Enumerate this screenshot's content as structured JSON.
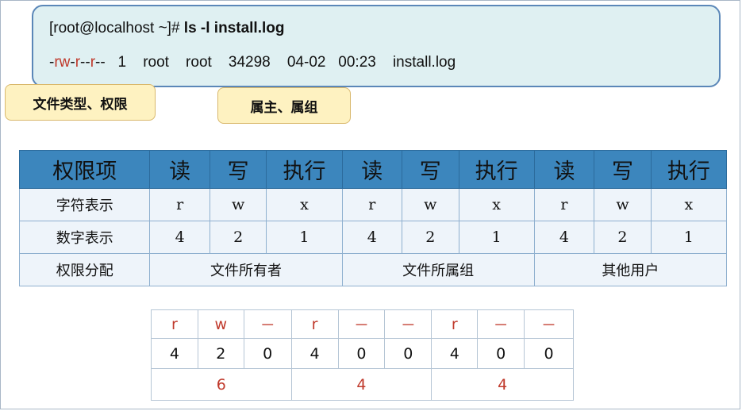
{
  "terminal": {
    "prompt": "[root@localhost ~]# ",
    "command": "ls -l install.log",
    "perm_plain_1": "-",
    "perm_red_1": "rw",
    "perm_plain_2": "-",
    "perm_red_2": "r",
    "perm_plain_3": "--",
    "perm_red_3": "r",
    "perm_plain_4": "--",
    "listing_rest": "   1    root    root    34298    04-02   00:23    install.log"
  },
  "callouts": {
    "type_perm": "文件类型、权限",
    "owner_group": "属主、属组"
  },
  "permission_table": {
    "header": [
      "权限项",
      "读",
      "写",
      "执行",
      "读",
      "写",
      "执行",
      "读",
      "写",
      "执行"
    ],
    "char_row": [
      "字符表示",
      "r",
      "w",
      "x",
      "r",
      "w",
      "x",
      "r",
      "w",
      "x"
    ],
    "num_row": [
      "数字表示",
      "4",
      "2",
      "1",
      "4",
      "2",
      "1",
      "4",
      "2",
      "1"
    ],
    "assign_row": [
      "权限分配",
      "文件所有者",
      "文件所属组",
      "其他用户"
    ]
  },
  "example_table": {
    "symbols": [
      "r",
      "w",
      "－",
      "r",
      "－",
      "－",
      "r",
      "－",
      "－"
    ],
    "numbers": [
      "4",
      "2",
      "0",
      "4",
      "0",
      "0",
      "4",
      "0",
      "0"
    ],
    "sums": [
      "6",
      "4",
      "4"
    ]
  }
}
